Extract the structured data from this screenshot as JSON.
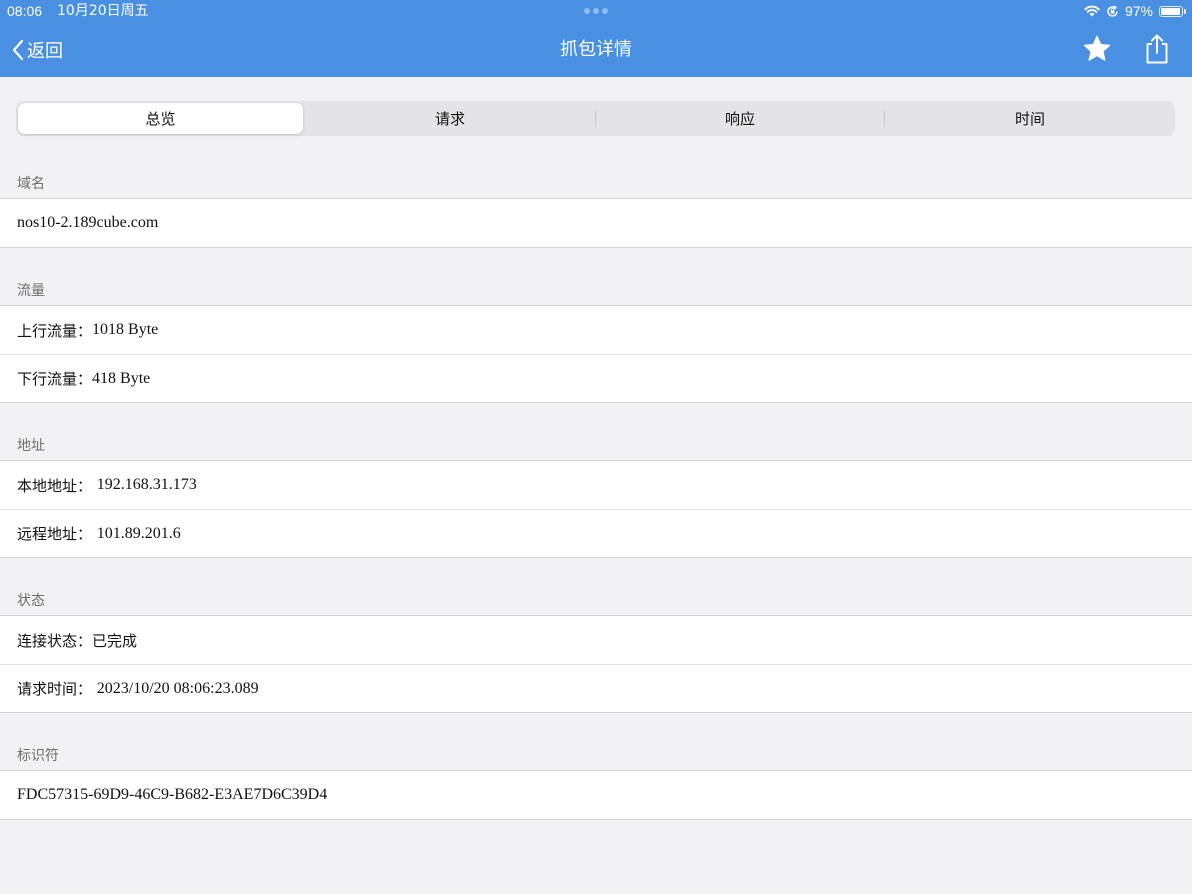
{
  "status_bar": {
    "time": "08:06",
    "date": "10月20日周五",
    "battery": "97%",
    "battery_level": 0.97
  },
  "nav": {
    "back_label": "返回",
    "title": "抓包详情"
  },
  "tabs": [
    {
      "label": "总览",
      "active": true
    },
    {
      "label": "请求",
      "active": false
    },
    {
      "label": "响应",
      "active": false
    },
    {
      "label": "时间",
      "active": false
    }
  ],
  "sections": [
    {
      "header": "域名",
      "rows": [
        {
          "label": "",
          "value": "nos10-2.189cube.com"
        }
      ]
    },
    {
      "header": "流量",
      "rows": [
        {
          "label": "上行流量：",
          "value": "1018 Byte"
        },
        {
          "label": "下行流量：",
          "value": "418 Byte"
        }
      ]
    },
    {
      "header": "地址",
      "rows": [
        {
          "label": "本地地址： ",
          "value": "192.168.31.173"
        },
        {
          "label": "远程地址： ",
          "value": "101.89.201.6"
        }
      ]
    },
    {
      "header": "状态",
      "rows": [
        {
          "label": "连接状态：",
          "value": "已完成"
        },
        {
          "label": "请求时间： ",
          "value": "2023/10/20 08:06:23.089"
        }
      ]
    },
    {
      "header": "标识符",
      "rows": [
        {
          "label": "",
          "value": "FDC57315-69D9-46C9-B682-E3AE7D6C39D4"
        }
      ]
    }
  ],
  "icons": {
    "back": "chevron-left-icon",
    "favorite": "star-icon",
    "share": "share-icon",
    "wifi": "wifi-icon",
    "orientation_lock": "orientation-lock-icon",
    "battery": "battery-icon"
  },
  "colors": {
    "nav_background": "#4a90e2",
    "page_background": "#f2f2f4",
    "section_header_text": "#6d6d72"
  }
}
